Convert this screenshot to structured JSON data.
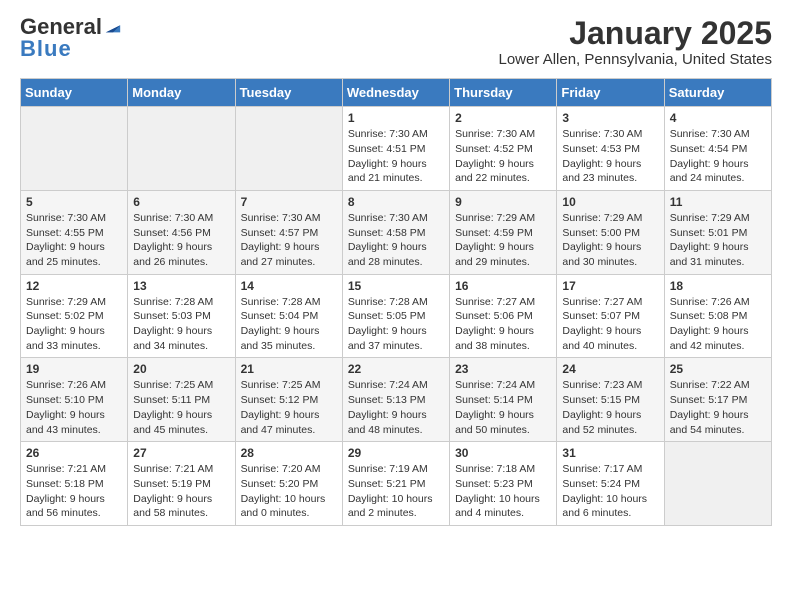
{
  "logo": {
    "general": "General",
    "blue": "Blue"
  },
  "title": "January 2025",
  "subtitle": "Lower Allen, Pennsylvania, United States",
  "days_of_week": [
    "Sunday",
    "Monday",
    "Tuesday",
    "Wednesday",
    "Thursday",
    "Friday",
    "Saturday"
  ],
  "weeks": [
    [
      {
        "day": "",
        "content": ""
      },
      {
        "day": "",
        "content": ""
      },
      {
        "day": "",
        "content": ""
      },
      {
        "day": "1",
        "content": "Sunrise: 7:30 AM\nSunset: 4:51 PM\nDaylight: 9 hours\nand 21 minutes."
      },
      {
        "day": "2",
        "content": "Sunrise: 7:30 AM\nSunset: 4:52 PM\nDaylight: 9 hours\nand 22 minutes."
      },
      {
        "day": "3",
        "content": "Sunrise: 7:30 AM\nSunset: 4:53 PM\nDaylight: 9 hours\nand 23 minutes."
      },
      {
        "day": "4",
        "content": "Sunrise: 7:30 AM\nSunset: 4:54 PM\nDaylight: 9 hours\nand 24 minutes."
      }
    ],
    [
      {
        "day": "5",
        "content": "Sunrise: 7:30 AM\nSunset: 4:55 PM\nDaylight: 9 hours\nand 25 minutes."
      },
      {
        "day": "6",
        "content": "Sunrise: 7:30 AM\nSunset: 4:56 PM\nDaylight: 9 hours\nand 26 minutes."
      },
      {
        "day": "7",
        "content": "Sunrise: 7:30 AM\nSunset: 4:57 PM\nDaylight: 9 hours\nand 27 minutes."
      },
      {
        "day": "8",
        "content": "Sunrise: 7:30 AM\nSunset: 4:58 PM\nDaylight: 9 hours\nand 28 minutes."
      },
      {
        "day": "9",
        "content": "Sunrise: 7:29 AM\nSunset: 4:59 PM\nDaylight: 9 hours\nand 29 minutes."
      },
      {
        "day": "10",
        "content": "Sunrise: 7:29 AM\nSunset: 5:00 PM\nDaylight: 9 hours\nand 30 minutes."
      },
      {
        "day": "11",
        "content": "Sunrise: 7:29 AM\nSunset: 5:01 PM\nDaylight: 9 hours\nand 31 minutes."
      }
    ],
    [
      {
        "day": "12",
        "content": "Sunrise: 7:29 AM\nSunset: 5:02 PM\nDaylight: 9 hours\nand 33 minutes."
      },
      {
        "day": "13",
        "content": "Sunrise: 7:28 AM\nSunset: 5:03 PM\nDaylight: 9 hours\nand 34 minutes."
      },
      {
        "day": "14",
        "content": "Sunrise: 7:28 AM\nSunset: 5:04 PM\nDaylight: 9 hours\nand 35 minutes."
      },
      {
        "day": "15",
        "content": "Sunrise: 7:28 AM\nSunset: 5:05 PM\nDaylight: 9 hours\nand 37 minutes."
      },
      {
        "day": "16",
        "content": "Sunrise: 7:27 AM\nSunset: 5:06 PM\nDaylight: 9 hours\nand 38 minutes."
      },
      {
        "day": "17",
        "content": "Sunrise: 7:27 AM\nSunset: 5:07 PM\nDaylight: 9 hours\nand 40 minutes."
      },
      {
        "day": "18",
        "content": "Sunrise: 7:26 AM\nSunset: 5:08 PM\nDaylight: 9 hours\nand 42 minutes."
      }
    ],
    [
      {
        "day": "19",
        "content": "Sunrise: 7:26 AM\nSunset: 5:10 PM\nDaylight: 9 hours\nand 43 minutes."
      },
      {
        "day": "20",
        "content": "Sunrise: 7:25 AM\nSunset: 5:11 PM\nDaylight: 9 hours\nand 45 minutes."
      },
      {
        "day": "21",
        "content": "Sunrise: 7:25 AM\nSunset: 5:12 PM\nDaylight: 9 hours\nand 47 minutes."
      },
      {
        "day": "22",
        "content": "Sunrise: 7:24 AM\nSunset: 5:13 PM\nDaylight: 9 hours\nand 48 minutes."
      },
      {
        "day": "23",
        "content": "Sunrise: 7:24 AM\nSunset: 5:14 PM\nDaylight: 9 hours\nand 50 minutes."
      },
      {
        "day": "24",
        "content": "Sunrise: 7:23 AM\nSunset: 5:15 PM\nDaylight: 9 hours\nand 52 minutes."
      },
      {
        "day": "25",
        "content": "Sunrise: 7:22 AM\nSunset: 5:17 PM\nDaylight: 9 hours\nand 54 minutes."
      }
    ],
    [
      {
        "day": "26",
        "content": "Sunrise: 7:21 AM\nSunset: 5:18 PM\nDaylight: 9 hours\nand 56 minutes."
      },
      {
        "day": "27",
        "content": "Sunrise: 7:21 AM\nSunset: 5:19 PM\nDaylight: 9 hours\nand 58 minutes."
      },
      {
        "day": "28",
        "content": "Sunrise: 7:20 AM\nSunset: 5:20 PM\nDaylight: 10 hours\nand 0 minutes."
      },
      {
        "day": "29",
        "content": "Sunrise: 7:19 AM\nSunset: 5:21 PM\nDaylight: 10 hours\nand 2 minutes."
      },
      {
        "day": "30",
        "content": "Sunrise: 7:18 AM\nSunset: 5:23 PM\nDaylight: 10 hours\nand 4 minutes."
      },
      {
        "day": "31",
        "content": "Sunrise: 7:17 AM\nSunset: 5:24 PM\nDaylight: 10 hours\nand 6 minutes."
      },
      {
        "day": "",
        "content": ""
      }
    ]
  ]
}
